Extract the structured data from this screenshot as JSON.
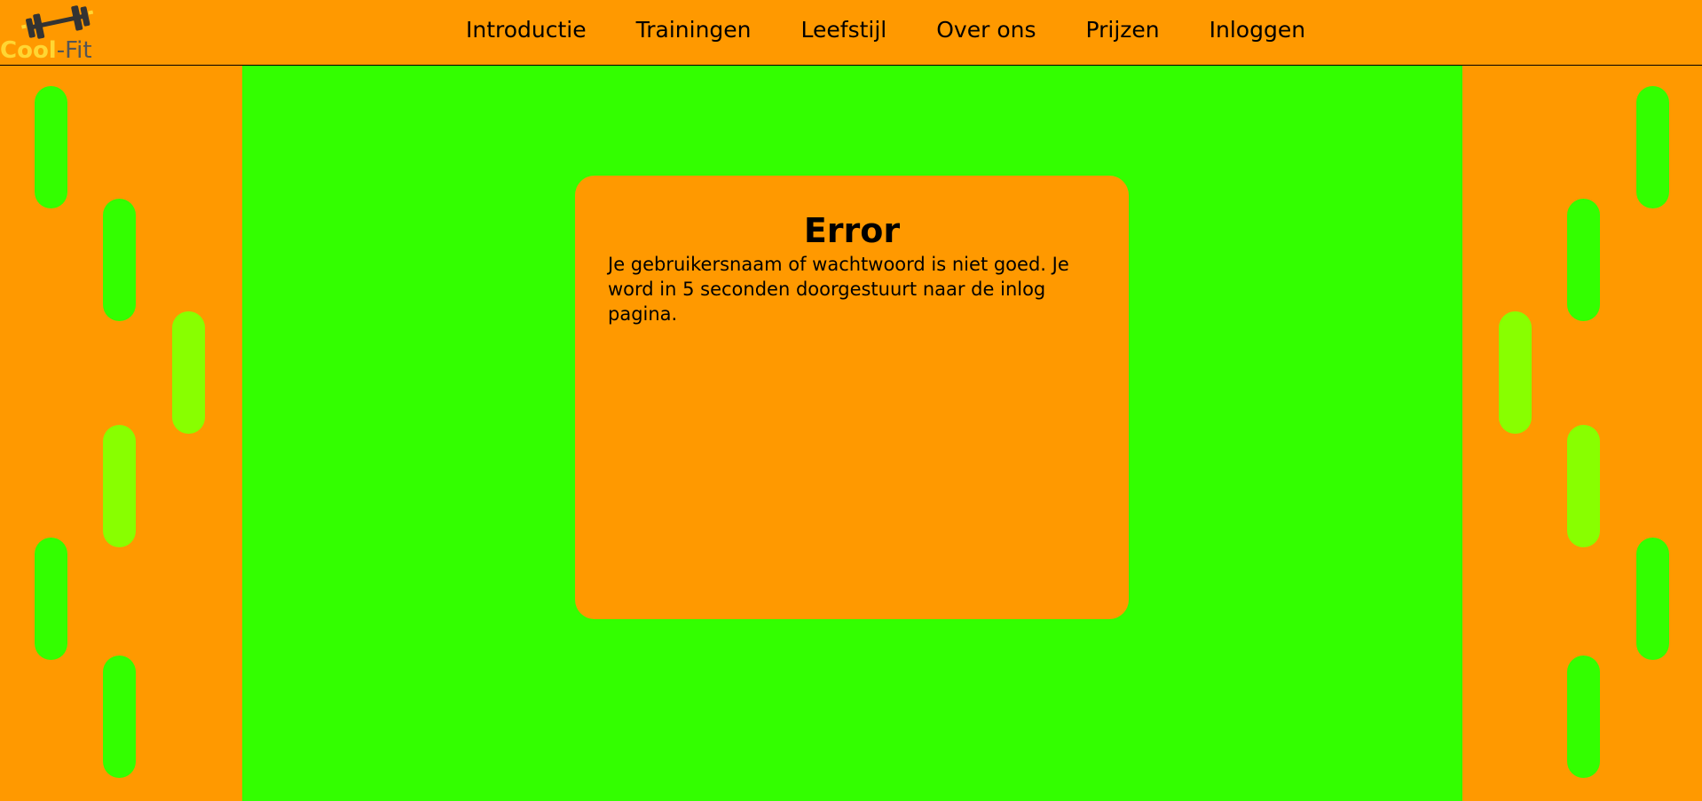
{
  "brand": {
    "logo_part1": "Cool",
    "logo_part2": "-Fit"
  },
  "nav": {
    "items": [
      {
        "label": "Introductie"
      },
      {
        "label": "Trainingen"
      },
      {
        "label": "Leefstijl"
      },
      {
        "label": "Over ons"
      },
      {
        "label": "Prijzen"
      },
      {
        "label": "Inloggen"
      }
    ]
  },
  "error_card": {
    "title": "Error",
    "message": "Je gebruikersnaam of wachtwoord is niet goed. Je word in 5 seconden doorgestuurt naar de inlog pagina."
  },
  "colors": {
    "background": "#ff9900",
    "panel": "#33ff00",
    "pill_green": "#33ff00",
    "pill_lime": "#88ff00",
    "logo_cool": "#ffd633",
    "logo_fit": "#555555"
  }
}
